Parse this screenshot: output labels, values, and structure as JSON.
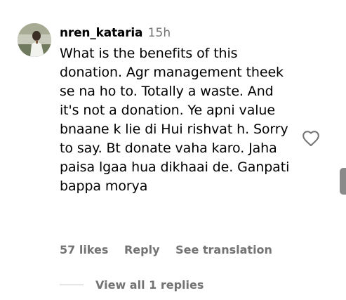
{
  "comment": {
    "username": "nren_kataria",
    "time": "15h",
    "text": "What is the benefits of this donation. Agr management theek se na ho to. Totally a waste. And it's not a donation. Ye apni value bnaane k lie di Hui rishvat h. Sorry to say. Bt donate vaha karo. Jaha paisa lgaa hua dikhaai de. Ganpati bappa morya",
    "likes": "57 likes",
    "reply_label": "Reply",
    "translate_label": "See translation",
    "view_replies": "View all 1 replies"
  },
  "icons": {
    "like": "heart-outline-icon"
  },
  "colors": {
    "primary_text": "#000000",
    "secondary_text": "#737373"
  }
}
